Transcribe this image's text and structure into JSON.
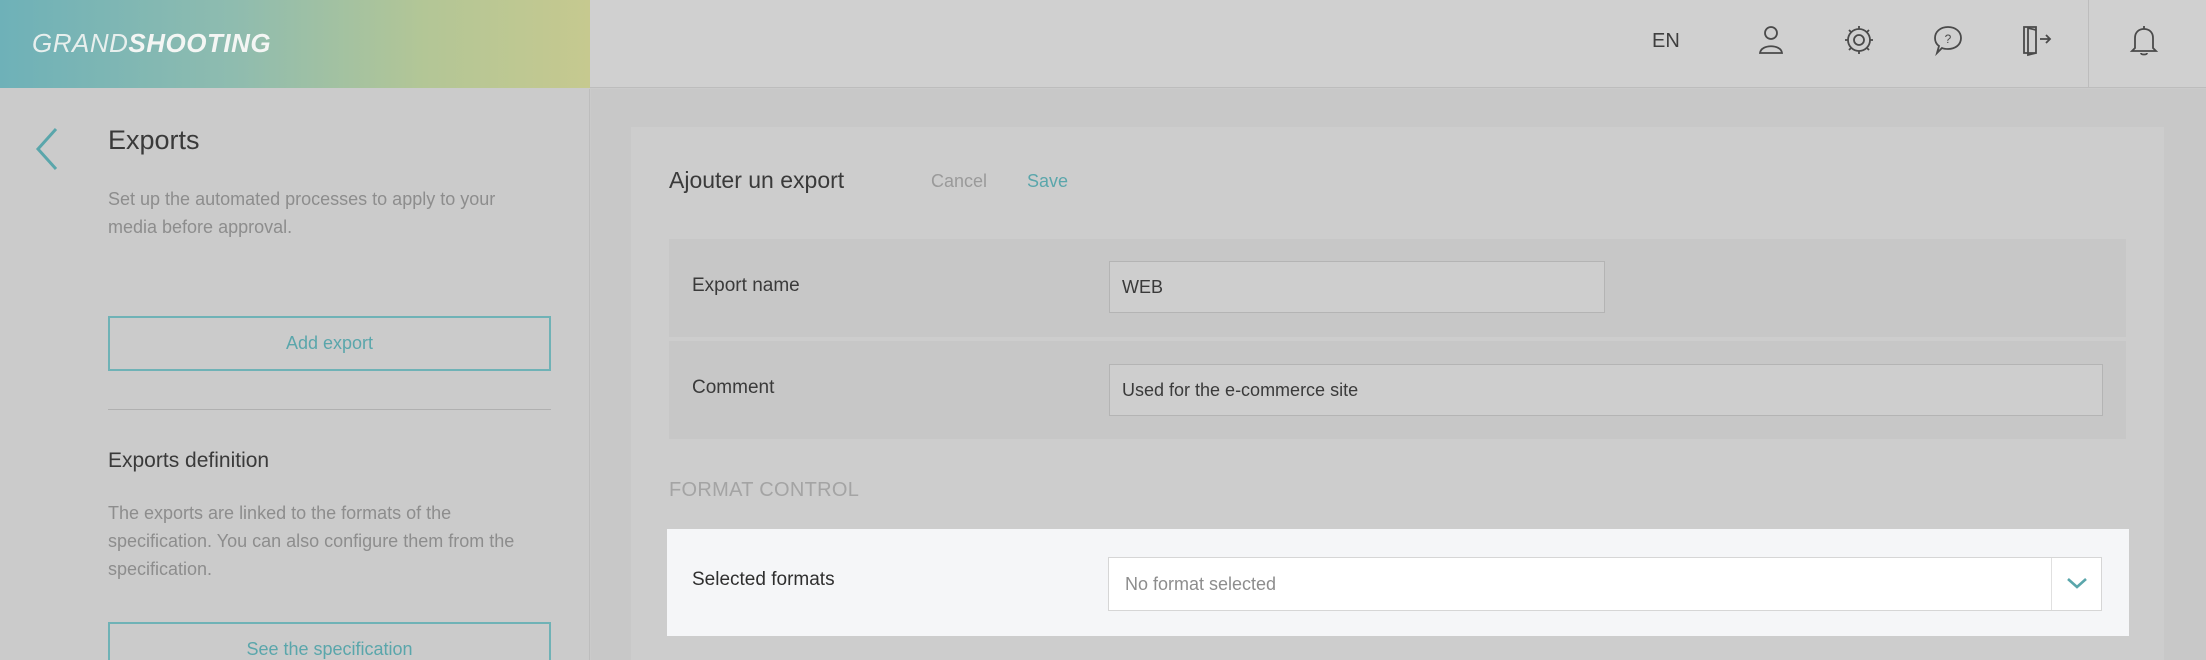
{
  "header": {
    "logo_light": "GRAND",
    "logo_bold": "SHOOTING",
    "language": "EN",
    "icons": [
      "user-icon",
      "gear-icon",
      "help-icon",
      "logout-icon",
      "bell-icon"
    ]
  },
  "sidebar": {
    "title": "Exports",
    "description": "Set up the automated processes to apply to your media before approval.",
    "add_export_label": "Add export",
    "definition_title": "Exports definition",
    "definition_description": "The exports are linked to the formats of the specification. You can also configure them from the specification.",
    "see_spec_label": "See the specification"
  },
  "form": {
    "title": "Ajouter un export",
    "cancel_label": "Cancel",
    "save_label": "Save",
    "fields": {
      "export_name": {
        "label": "Export name",
        "value": "WEB"
      },
      "comment": {
        "label": "Comment",
        "value": "Used for the e-commerce site"
      }
    },
    "format_control": {
      "section_title": "FORMAT CONTROL",
      "selected_formats_label": "Selected formats",
      "selected_formats_value": "No format selected"
    }
  },
  "colors": {
    "accent": "#5aa6ab",
    "logo_gradient_start": "#6eb1b8",
    "logo_gradient_end": "#c6c98f"
  }
}
